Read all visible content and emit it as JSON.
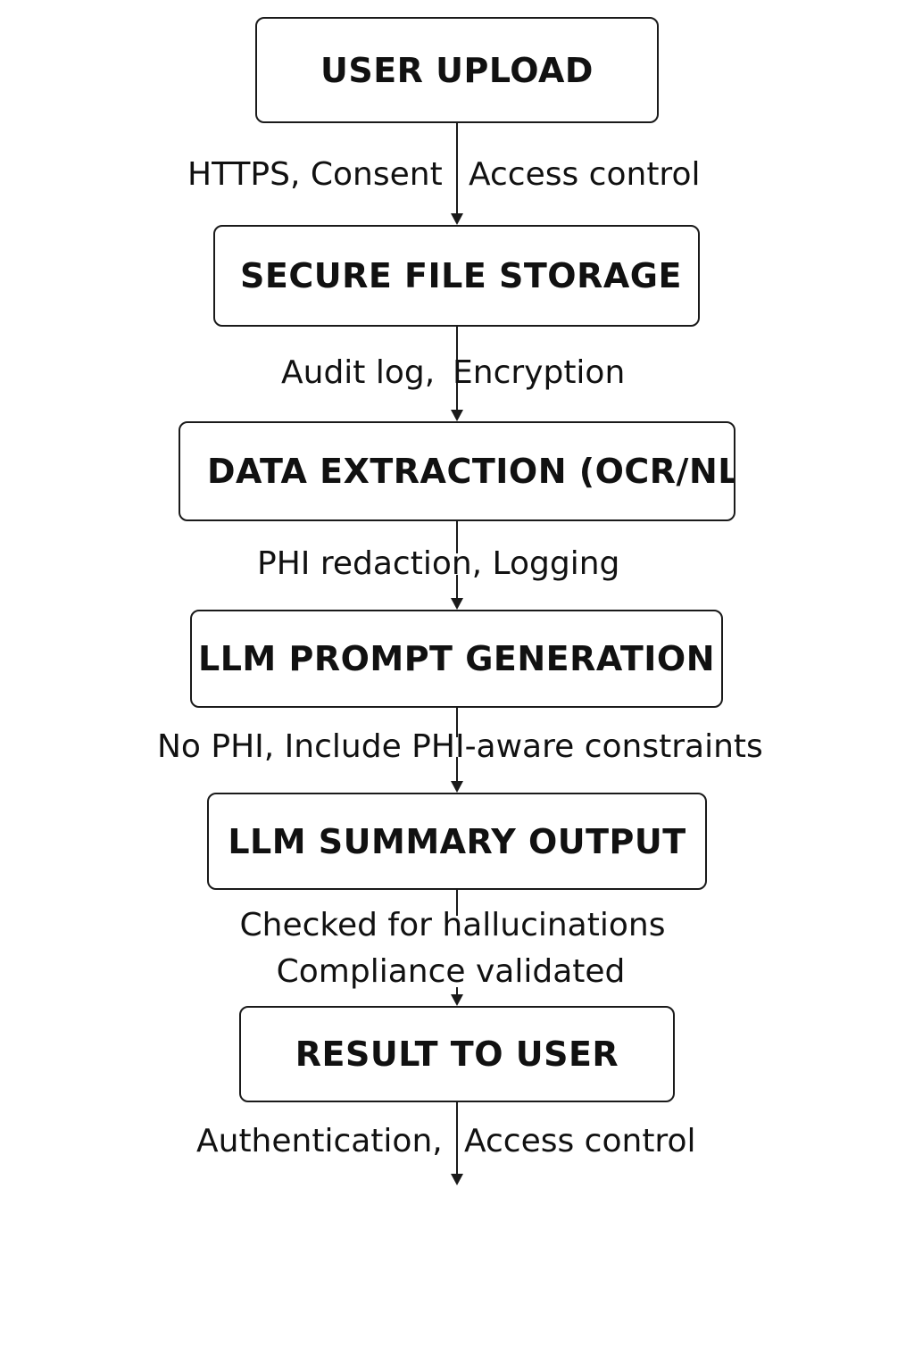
{
  "flow": {
    "steps": [
      {
        "label": "USER UPLOAD"
      },
      {
        "label": "SECURE FILE STORAGE"
      },
      {
        "label": "DATA EXTRACTION (OCR/NLP"
      },
      {
        "label": "LLM PROMPT GENERATION"
      },
      {
        "label": "LLM SUMMARY OUTPUT"
      },
      {
        "label": "RESULT TO USER"
      }
    ],
    "connectors": [
      {
        "left": "HTTPS, Consent",
        "right": "Access control"
      },
      {
        "left": "Audit log,",
        "right": "Encryption"
      },
      {
        "text": "PHI redaction, Logging"
      },
      {
        "text": "No PHI, Include PHI-aware constraints"
      },
      {
        "line1": "Checked for hallucinations",
        "line2": "Compliance validated"
      },
      {
        "left": "Authentication,",
        "right": "Access control"
      }
    ]
  },
  "colors": {
    "stroke": "#1a1a1a",
    "text": "#111111",
    "background": "#ffffff"
  }
}
